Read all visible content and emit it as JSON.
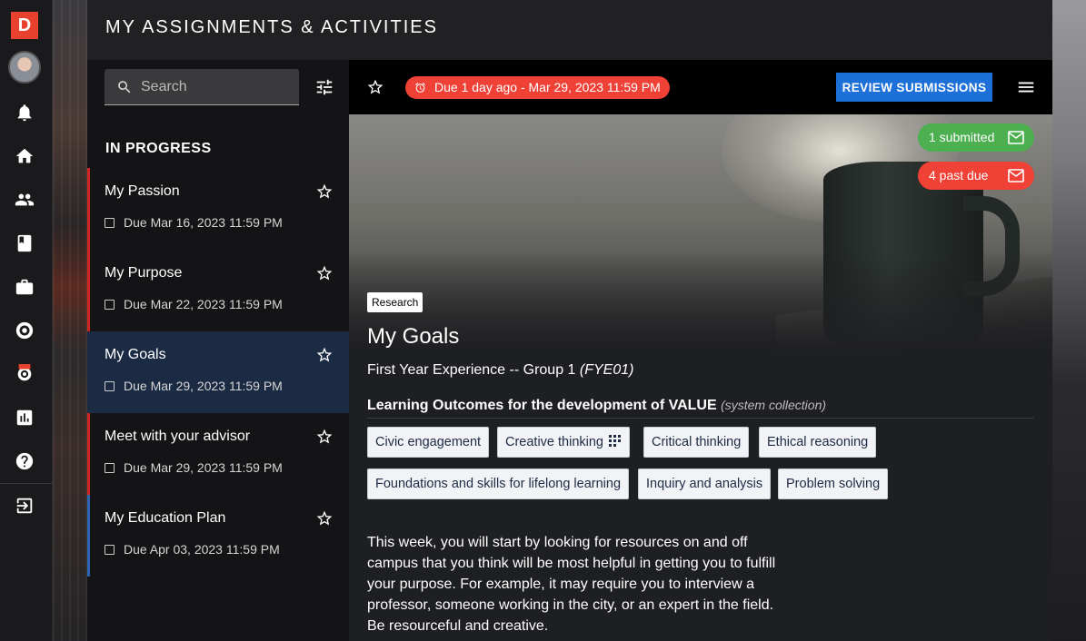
{
  "app": {
    "logo_letter": "D",
    "header_title": "MY ASSIGNMENTS & ACTIVITIES"
  },
  "rail_icons": [
    "bell-icon",
    "home-icon",
    "people-icon",
    "book-icon",
    "briefcase-icon",
    "settings-gear-icon",
    "beta-settings-icon",
    "chart-icon",
    "help-icon",
    "logout-icon"
  ],
  "search": {
    "placeholder": "Search",
    "value": ""
  },
  "list": {
    "section_title": "IN PROGRESS",
    "items": [
      {
        "title": "My Passion",
        "due": "Due Mar 16, 2023 11:59 PM",
        "accent": "#d0261f",
        "selected": false
      },
      {
        "title": "My Purpose",
        "due": "Due Mar 22, 2023 11:59 PM",
        "accent": "#d0261f",
        "selected": false
      },
      {
        "title": "My Goals",
        "due": "Due Mar 29, 2023 11:59 PM",
        "accent": "#d0261f",
        "selected": true
      },
      {
        "title": "Meet with your advisor",
        "due": "Due Mar 29, 2023 11:59 PM",
        "accent": "#d0261f",
        "selected": false
      },
      {
        "title": "My Education Plan",
        "due": "Due Apr 03, 2023 11:59 PM",
        "accent": "#2b66b3",
        "selected": false
      }
    ]
  },
  "toolbar": {
    "due_status": "Due 1 day ago - Mar 29, 2023 11:59 PM",
    "review_label": "REVIEW SUBMISSIONS"
  },
  "detail": {
    "submitted_badge": "1 submitted",
    "past_due_badge": "4 past due",
    "tag": "Research",
    "title": "My Goals",
    "course": "First Year Experience -- Group 1",
    "course_code": "(FYE01)",
    "outcomes_heading": "Learning Outcomes for the development of VALUE",
    "outcomes_collection": "(system collection)",
    "outcomes": [
      "Civic engagement",
      "Creative thinking",
      "Critical thinking",
      "Ethical reasoning",
      "Foundations and skills for lifelong learning",
      "Inquiry and analysis",
      "Problem solving"
    ],
    "description": "This week, you will start by looking for resources on and off campus that you think will be most helpful in getting you to fulfill your purpose. For example, it may require you to interview a professor, someone working in the city, or an expert in the field. Be resourceful and creative."
  },
  "colors": {
    "accent_red": "#ef4136",
    "accent_blue": "#1d70d8",
    "success_green": "#4caf50",
    "selected_row": "#1c2b44"
  }
}
